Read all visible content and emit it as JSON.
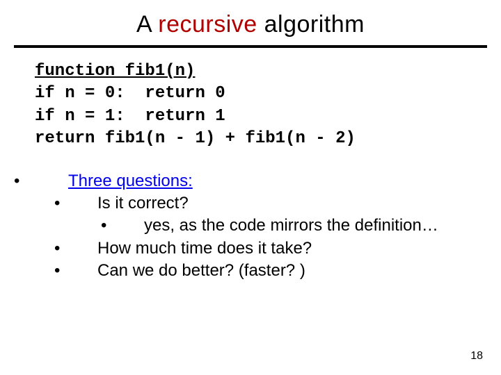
{
  "title": {
    "pre": "A ",
    "em": "recursive",
    "post": " algorithm"
  },
  "code": {
    "sig": "function fib1(n)",
    "l1": "if n = 0:  return 0",
    "l2": "if n = 1:  return 1",
    "l3": "return fib1(n - 1) + fib1(n - 2)"
  },
  "body": {
    "lead": "Three questions:",
    "q1": "Is it correct?",
    "q1a": "yes, as the code mirrors the definition…",
    "q2": "How much time does it take?",
    "q3": "Can we do better? (faster? )"
  },
  "bullet": "•",
  "page": "18"
}
